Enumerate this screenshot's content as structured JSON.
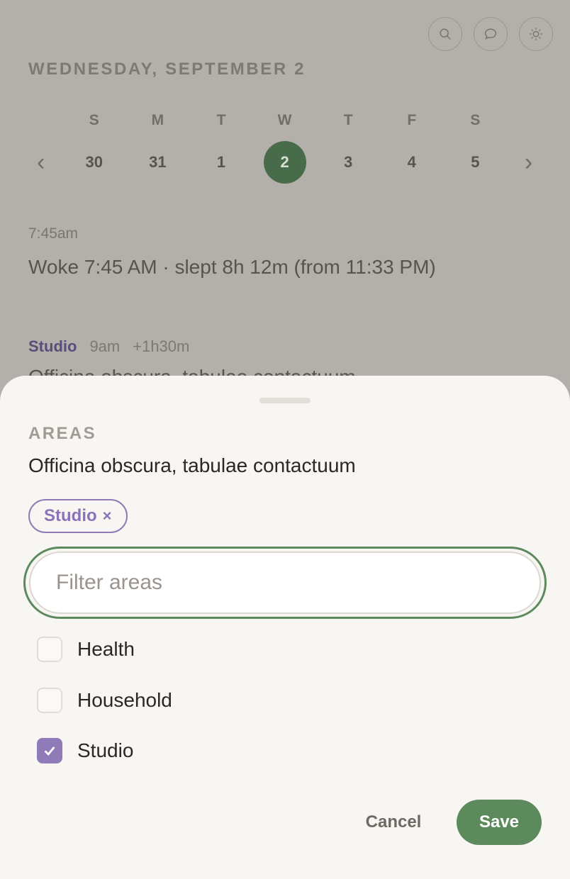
{
  "header": {
    "date_title": "WEDNESDAY, SEPTEMBER 2",
    "icons": [
      "search-icon",
      "comment-icon",
      "sun-icon"
    ]
  },
  "week": {
    "prev": "‹",
    "next": "›",
    "days": [
      {
        "letter": "S",
        "date": "30"
      },
      {
        "letter": "M",
        "date": "31"
      },
      {
        "letter": "T",
        "date": "1"
      },
      {
        "letter": "W",
        "date": "2",
        "selected": true
      },
      {
        "letter": "T",
        "date": "3"
      },
      {
        "letter": "F",
        "date": "4"
      },
      {
        "letter": "S",
        "date": "5"
      }
    ]
  },
  "entries": [
    {
      "time": "7:45am",
      "text": "Woke 7:45 AM · slept 8h 12m (from 11:33 PM)"
    }
  ],
  "event": {
    "area": "Studio",
    "time": "9am",
    "duration": "+1h30m",
    "title": "Officina obscura, tabulae contactuum"
  },
  "sheet": {
    "label": "AREAS",
    "subtitle": "Officina obscura, tabulae contactuum",
    "chip": {
      "label": "Studio",
      "remove": "×"
    },
    "filter_placeholder": "Filter areas",
    "filter_value": "",
    "options": [
      {
        "label": "Health",
        "checked": false
      },
      {
        "label": "Household",
        "checked": false
      },
      {
        "label": "Studio",
        "checked": true
      }
    ],
    "cancel_label": "Cancel",
    "save_label": "Save"
  },
  "colors": {
    "accent_green": "#5c8a5d",
    "selected_day": "#486b4a",
    "area_purple": "#8f7bb8",
    "overlay": "#b3afaa"
  }
}
